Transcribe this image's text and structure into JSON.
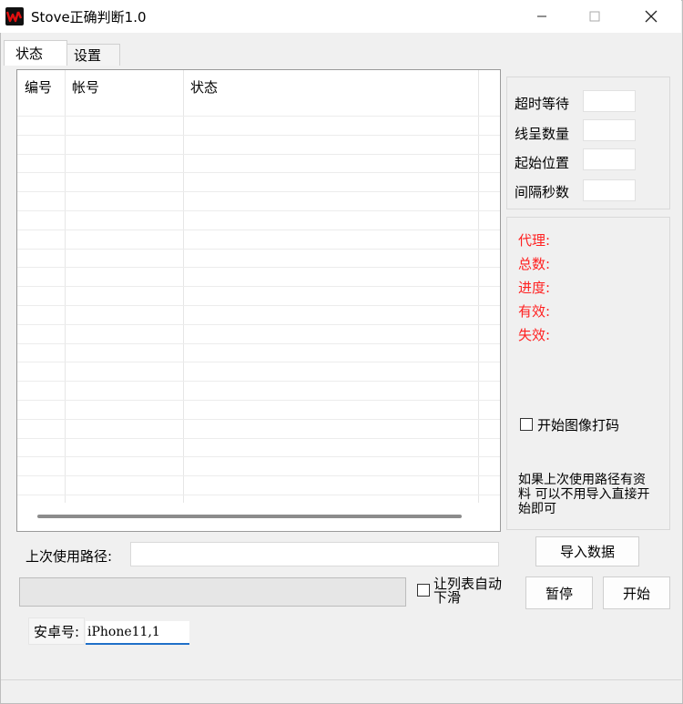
{
  "window": {
    "title": "Stove正确判断1.0"
  },
  "tabs": [
    {
      "label": "状态",
      "active": true
    },
    {
      "label": "设置",
      "active": false
    }
  ],
  "table": {
    "columns": [
      "编号",
      "帐号",
      "状态"
    ]
  },
  "settings": {
    "timeout_label": "超时等待",
    "threads_label": "线呈数量",
    "start_label": "起始位置",
    "interval_label": "间隔秒数"
  },
  "stats": {
    "proxy": "代理:",
    "total": "总数:",
    "progress": "进度:",
    "valid": "有效:",
    "invalid": "失效:",
    "color": "#ff2020"
  },
  "image_captcha_label": "开始图像打码",
  "hint": "如果上次使用路径有资料 可以不用导入直接开始即可",
  "import_button": "导入数据",
  "last_path_label": "上次使用路径:",
  "auto_scroll_label": "让列表自动下滑",
  "pause_button": "暂停",
  "start_button": "开始",
  "android_label": "安卓号:",
  "android_value": "iPhone11,1"
}
